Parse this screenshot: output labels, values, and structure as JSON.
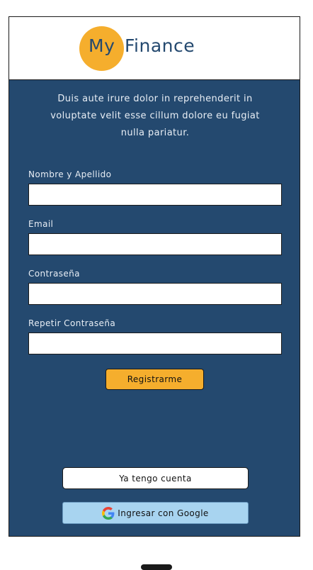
{
  "header": {
    "logo_my": "My",
    "logo_finance": "Finance"
  },
  "intro": {
    "text": "Duis aute irure dolor in reprehenderit in voluptate velit esse cillum dolore eu fugiat nulla pariatur."
  },
  "form": {
    "fields": [
      {
        "label": "Nombre y Apellido",
        "value": "",
        "placeholder": ""
      },
      {
        "label": "Email",
        "value": "",
        "placeholder": ""
      },
      {
        "label": "Contraseña",
        "value": "",
        "placeholder": ""
      },
      {
        "label": "Repetir Contraseña",
        "value": "",
        "placeholder": ""
      }
    ],
    "register_label": "Registrarme"
  },
  "actions": {
    "have_account_label": "Ya tengo cuenta",
    "google_label": "Ingresar con Google"
  },
  "icons": {
    "google": "google-icon"
  },
  "colors": {
    "brand_blue": "#24496f",
    "brand_orange": "#f5ae2d",
    "google_button": "#a8d4f0"
  }
}
